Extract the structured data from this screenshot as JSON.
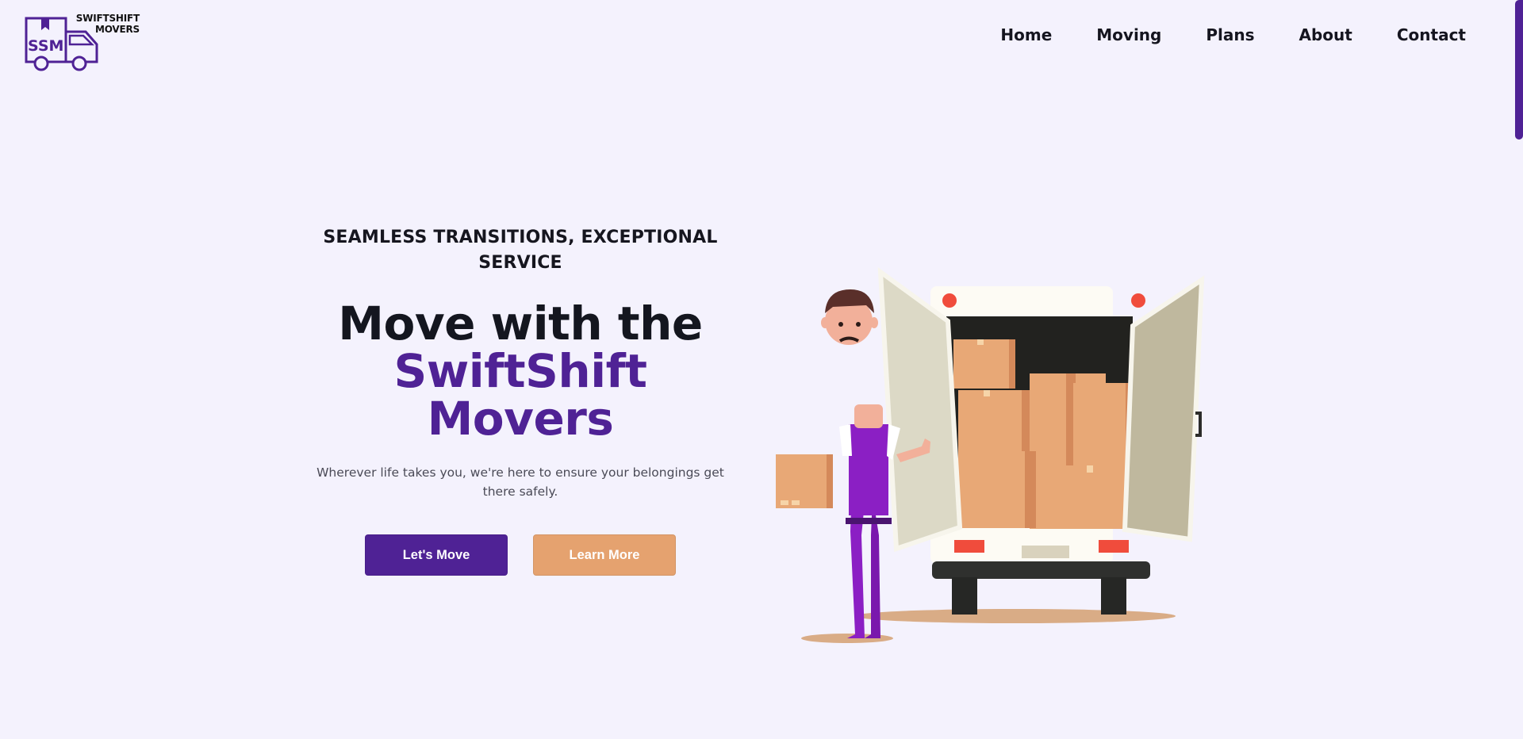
{
  "brand": {
    "logo_line1": "SWIFTSHIFT",
    "logo_line2": "MOVERS",
    "logo_monogram": "SSM",
    "color_primary": "#4f2295",
    "color_accent": "#e5a26f"
  },
  "nav": {
    "items": [
      {
        "label": "Home"
      },
      {
        "label": "Moving"
      },
      {
        "label": "Plans"
      },
      {
        "label": "About"
      },
      {
        "label": "Contact"
      }
    ]
  },
  "hero": {
    "tagline": "SEAMLESS TRANSITIONS, EXCEPTIONAL SERVICE",
    "headline_line1": "Move with the",
    "headline_line2": "SwiftShift Movers",
    "subtext": "Wherever life takes you, we're here to ensure your belongings get there safely.",
    "primary_button": "Let's Move",
    "secondary_button": "Learn More"
  },
  "icons": {
    "logo": "truck-logo-icon",
    "illustration": "mover-with-truck-illustration"
  }
}
